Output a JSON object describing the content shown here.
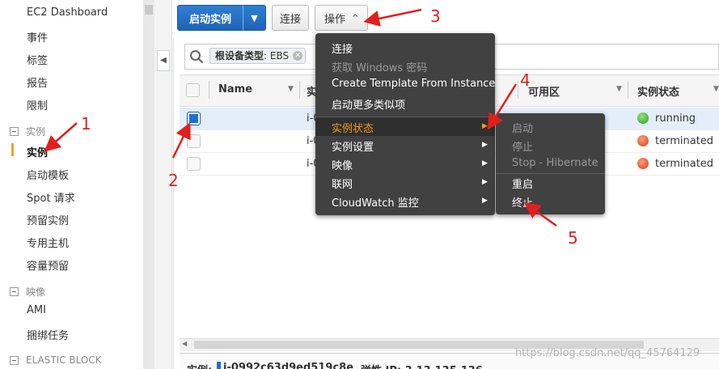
{
  "sidebar": {
    "top_items": [
      "EC2 Dashboard",
      "事件",
      "标签",
      "报告",
      "限制"
    ],
    "group_instances": "实例",
    "instance_items": [
      "实例",
      "启动模板",
      "Spot 请求",
      "预留实例",
      "专用主机",
      "容量预留"
    ],
    "group_images": "映像",
    "image_items": [
      "AMI",
      "捆绑任务"
    ],
    "group_ebs": "ELASTIC BLOCK"
  },
  "toolbar": {
    "launch_label": "启动实例",
    "connect_label": "连接",
    "actions_label": "操作"
  },
  "filter": {
    "token_key": "根设备类型",
    "token_value": ": EBS"
  },
  "table": {
    "col_name": "Name",
    "col_instance_partial": "实",
    "col_az": "可用区",
    "col_state": "实例状态",
    "rows": [
      {
        "id_partial": "i-0",
        "state": "running"
      },
      {
        "id_partial": "i-0",
        "state": "terminated"
      },
      {
        "id_partial": "i-0",
        "state": "terminated"
      }
    ]
  },
  "detail": {
    "instance_label": "实例:",
    "instance_id": "i-0992c63d9ed519c8e",
    "ip_label": "弹性 IP: 3.13.135.136"
  },
  "actions_menu": {
    "items": [
      {
        "label": "连接",
        "disabled": false
      },
      {
        "label": "获取 Windows 密码",
        "disabled": true
      },
      {
        "label": "Create Template From Instance",
        "disabled": false
      },
      {
        "label": "启动更多类似项",
        "disabled": false
      }
    ],
    "sub_items": [
      {
        "label": "实例状态",
        "highlight": true
      },
      {
        "label": "实例设置"
      },
      {
        "label": "映像"
      },
      {
        "label": "联网"
      },
      {
        "label": "CloudWatch 监控"
      }
    ]
  },
  "state_menu": {
    "items": [
      {
        "label": "启动",
        "disabled": true
      },
      {
        "label": "停止",
        "disabled": true
      },
      {
        "label": "Stop - Hibernate",
        "disabled": true
      },
      {
        "label": "重启",
        "disabled": false
      },
      {
        "label": "终止",
        "disabled": false
      }
    ]
  },
  "annotations": [
    "1",
    "2",
    "3",
    "4",
    "5"
  ],
  "watermark": "https://blog.csdn.net/qq_45764129",
  "colors": {
    "primary_blue": "#1e63b5",
    "highlight_orange": "#f39a21",
    "active_bar": "#f0a028",
    "annotation_red": "#e0201e",
    "running_green": "#2f9a1d",
    "terminated_red": "#d2401b"
  }
}
